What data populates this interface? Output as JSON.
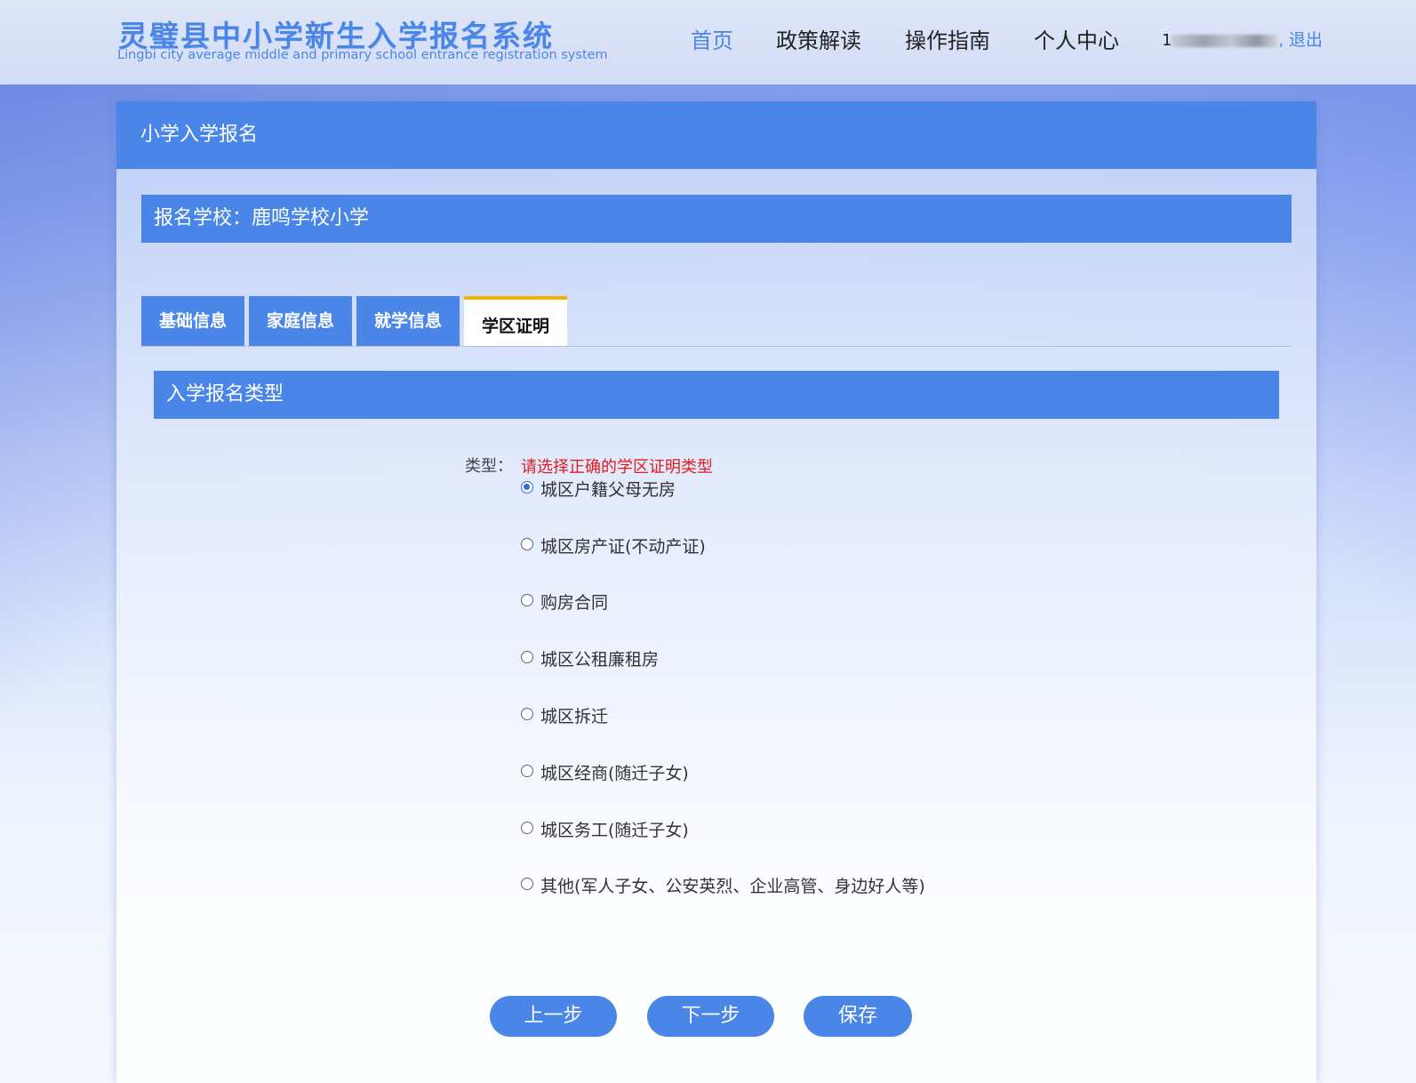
{
  "header": {
    "logo_cn": "灵璧县中小学新生入学报名系统",
    "logo_en": "Lingbi city average middle and primary school entrance registration system",
    "nav": [
      "首页",
      "政策解读",
      "操作指南",
      "个人中心"
    ],
    "user_prefix": "1",
    "logout": "退出"
  },
  "card": {
    "title": "小学入学报名",
    "school_label": "报名学校：鹿鸣学校小学",
    "tabs": [
      "基础信息",
      "家庭信息",
      "就学信息",
      "学区证明"
    ],
    "active_tab": "学区证明",
    "section_title": "入学报名类型",
    "type_label": "类型：",
    "type_hint": "请选择正确的学区证明类型",
    "options": [
      "城区户籍父母无房",
      "城区房产证(不动产证)",
      "购房合同",
      "城区公租廉租房",
      "城区拆迁",
      "城区经商(随迁子女)",
      "城区务工(随迁子女)",
      "其他(军人子女、公安英烈、企业高管、身边好人等)"
    ],
    "selected_option": "城区户籍父母无房",
    "buttons": {
      "prev": "上一步",
      "next": "下一步",
      "save": "保存"
    }
  },
  "colors": {
    "primary": "#4a86e8",
    "active_tab_border": "#f5b400",
    "hint": "#e11d1d"
  }
}
